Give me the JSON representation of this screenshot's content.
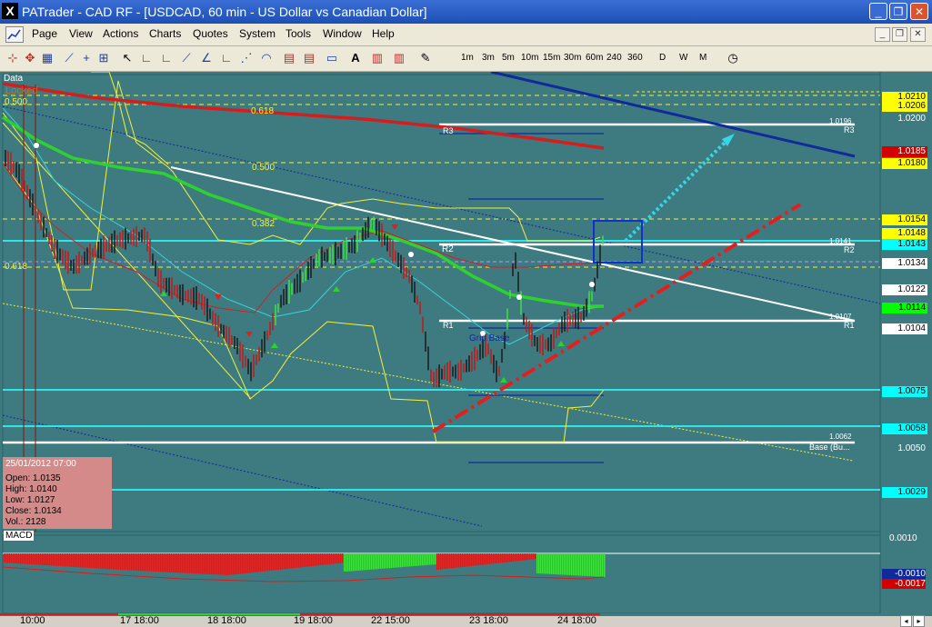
{
  "window": {
    "app_letter": "X",
    "title": "PATrader - CAD RF - [USDCAD, 60 min - US Dollar vs Canadian Dollar]",
    "min": "_",
    "max": "❐",
    "close": "✕"
  },
  "menu": {
    "items": [
      "Page",
      "Actions",
      "Actions",
      "Charts",
      "Quotes",
      "System",
      "Tools",
      "Window",
      "Help"
    ],
    "labels": {
      "page": "Page",
      "view": "View",
      "actions": "Actions",
      "charts": "Charts",
      "quotes": "Quotes",
      "system": "System",
      "tools": "Tools",
      "window": "Window",
      "help": "Help"
    }
  },
  "toolbar": {
    "timeframes": [
      "1m",
      "3m",
      "5m",
      "10m",
      "15m",
      "30m",
      "60m",
      "240",
      "360"
    ],
    "periods": [
      "D",
      "W",
      "M"
    ]
  },
  "chart": {
    "data_label": "Data",
    "locked_label": "Locked",
    "fib_labels": {
      "f500_top": "0.500",
      "f618_a": "0.618",
      "f500_b": "0.500",
      "f382": "0.382",
      "f618_left": "0.618"
    },
    "pivot_labels": {
      "r3": "R3",
      "r2": "R2",
      "r1": "R1",
      "base": "Base (Bu...",
      "grid_base": "Grid Base"
    },
    "line_values": {
      "v1": "1.0196",
      "v2": "1.0141",
      "v3": "1.0107",
      "v4": "1.0062"
    },
    "price_labels": [
      {
        "text": "1.0210",
        "bg": "#ffff00",
        "fg": "#000"
      },
      {
        "text": "1.0206",
        "bg": "#ffff00",
        "fg": "#000"
      },
      {
        "text": "1.0200",
        "bg": "#3e7b80",
        "fg": "#ffffff"
      },
      {
        "text": "1.0185",
        "bg": "#d40000",
        "fg": "#ffffff"
      },
      {
        "text": "1.0180",
        "bg": "#ffff00",
        "fg": "#000"
      },
      {
        "text": "1.0154",
        "bg": "#ffff00",
        "fg": "#000"
      },
      {
        "text": "1.0148",
        "bg": "#ffff00",
        "fg": "#000"
      },
      {
        "text": "1.0143",
        "bg": "#00ffff",
        "fg": "#000"
      },
      {
        "text": "1.0134",
        "bg": "#ffffff",
        "fg": "#000"
      },
      {
        "text": "1.0122",
        "bg": "#ffffff",
        "fg": "#000"
      },
      {
        "text": "1.0114",
        "bg": "#00ff00",
        "fg": "#000"
      },
      {
        "text": "1.0104",
        "bg": "#ffffff",
        "fg": "#000"
      },
      {
        "text": "1.0075",
        "bg": "#00ffff",
        "fg": "#000"
      },
      {
        "text": "1.0058",
        "bg": "#00ffff",
        "fg": "#000"
      },
      {
        "text": "1.0050",
        "bg": "#3e7b80",
        "fg": "#ffffff"
      },
      {
        "text": "1.0029",
        "bg": "#00ffff",
        "fg": "#000"
      }
    ],
    "ohlc": {
      "datetime": "25/01/2012 07:00",
      "open": "Open: 1.0135",
      "high": "High: 1.0140",
      "low": "Low: 1.0127",
      "close": "Close: 1.0134",
      "vol": "Vol.: 2128"
    },
    "macd": {
      "label": "MACD",
      "top_value": "0.0010",
      "val1": "-0.0010",
      "val2": "-0.0017"
    },
    "time_labels": [
      "10:00",
      "17 18:00",
      "18 18:00",
      "19 18:00",
      "22 15:00",
      "23 18:00",
      "24 18:00"
    ],
    "colors": {
      "background": "#3e7b80",
      "ma_red": "#d41e1e",
      "ma_green": "#2fd12f",
      "trend_navy": "#102a9c",
      "channel_yellow": "#f5f03a",
      "pivot_white": "#ffffff",
      "level_cyan": "#2ee6e6"
    }
  }
}
